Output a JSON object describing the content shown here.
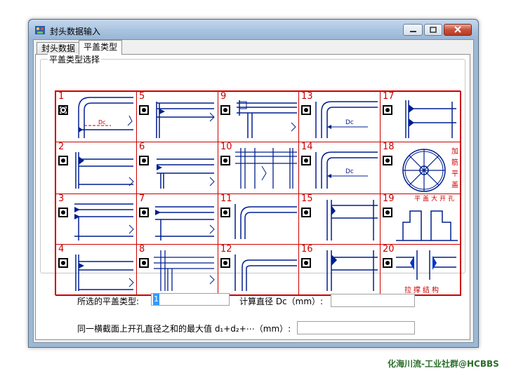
{
  "window": {
    "title": "封头数据输入"
  },
  "tabs": [
    {
      "label": "封头数据"
    },
    {
      "label": "平盖类型"
    }
  ],
  "group": {
    "label": "平盖类型选择"
  },
  "cells": [
    {
      "num": "1"
    },
    {
      "num": "5"
    },
    {
      "num": "9"
    },
    {
      "num": "13"
    },
    {
      "num": "17"
    },
    {
      "num": "2"
    },
    {
      "num": "6"
    },
    {
      "num": "10"
    },
    {
      "num": "14"
    },
    {
      "num": "18"
    },
    {
      "num": "3"
    },
    {
      "num": "7"
    },
    {
      "num": "11"
    },
    {
      "num": "15"
    },
    {
      "num": "19"
    },
    {
      "num": "4"
    },
    {
      "num": "8"
    },
    {
      "num": "12"
    },
    {
      "num": "16"
    },
    {
      "num": "20"
    }
  ],
  "drawing_labels": {
    "dc": "Dc",
    "c18": "加筋平盖",
    "c19": "平盖大开孔",
    "c20": "拉撑结构"
  },
  "form": {
    "type_label": "所选的平盖类型:",
    "type_value": "1",
    "dc_label": "计算直径 Dc（mm）:",
    "dc_value": "",
    "max_label": "同一横截面上开孔直径之和的最大值  d₁+d₂+⋯（mm）:",
    "max_value": ""
  },
  "watermark": "化海川流-工业社群@HCBBS"
}
